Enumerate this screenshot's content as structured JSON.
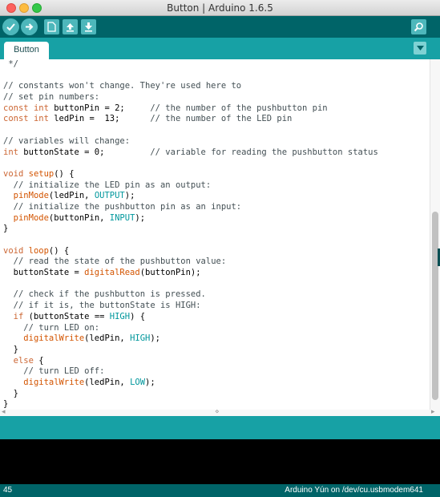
{
  "window": {
    "title": "Button | Arduino 1.6.5"
  },
  "toolbar": {
    "buttons": [
      {
        "name": "verify",
        "icon": "check-icon"
      },
      {
        "name": "upload",
        "icon": "arrow-right-icon"
      },
      {
        "name": "new",
        "icon": "new-file-icon"
      },
      {
        "name": "open",
        "icon": "open-arrow-up-icon"
      },
      {
        "name": "save",
        "icon": "save-arrow-down-icon"
      }
    ],
    "serial_monitor_icon": "magnifier-icon"
  },
  "tabs": {
    "active_label": "Button",
    "menu_icon": "triangle-down-icon"
  },
  "editor": {
    "lines": [
      [
        {
          "t": " */",
          "c": "com"
        }
      ],
      [
        {
          "t": "",
          "c": ""
        }
      ],
      [
        {
          "t": "// constants won't change. They're used here to",
          "c": "com"
        }
      ],
      [
        {
          "t": "// set pin numbers:",
          "c": "com"
        }
      ],
      [
        {
          "t": "const",
          "c": "kw"
        },
        {
          "t": " ",
          "c": ""
        },
        {
          "t": "int",
          "c": "kw"
        },
        {
          "t": " buttonPin = 2;     ",
          "c": ""
        },
        {
          "t": "// the number of the pushbutton pin",
          "c": "com"
        }
      ],
      [
        {
          "t": "const",
          "c": "kw"
        },
        {
          "t": " ",
          "c": ""
        },
        {
          "t": "int",
          "c": "kw"
        },
        {
          "t": " ledPin =  13;      ",
          "c": ""
        },
        {
          "t": "// the number of the LED pin",
          "c": "com"
        }
      ],
      [
        {
          "t": "",
          "c": ""
        }
      ],
      [
        {
          "t": "// variables will change:",
          "c": "com"
        }
      ],
      [
        {
          "t": "int",
          "c": "kw"
        },
        {
          "t": " buttonState = 0;         ",
          "c": ""
        },
        {
          "t": "// variable for reading the pushbutton status",
          "c": "com"
        }
      ],
      [
        {
          "t": "",
          "c": ""
        }
      ],
      [
        {
          "t": "void",
          "c": "kw"
        },
        {
          "t": " ",
          "c": ""
        },
        {
          "t": "setup",
          "c": "fn"
        },
        {
          "t": "() {",
          "c": ""
        }
      ],
      [
        {
          "t": "  ",
          "c": ""
        },
        {
          "t": "// initialize the LED pin as an output:",
          "c": "com"
        }
      ],
      [
        {
          "t": "  ",
          "c": ""
        },
        {
          "t": "pinMode",
          "c": "fn"
        },
        {
          "t": "(ledPin, ",
          "c": ""
        },
        {
          "t": "OUTPUT",
          "c": "cst"
        },
        {
          "t": ");",
          "c": ""
        }
      ],
      [
        {
          "t": "  ",
          "c": ""
        },
        {
          "t": "// initialize the pushbutton pin as an input:",
          "c": "com"
        }
      ],
      [
        {
          "t": "  ",
          "c": ""
        },
        {
          "t": "pinMode",
          "c": "fn"
        },
        {
          "t": "(buttonPin, ",
          "c": ""
        },
        {
          "t": "INPUT",
          "c": "cst"
        },
        {
          "t": ");",
          "c": ""
        }
      ],
      [
        {
          "t": "}",
          "c": ""
        }
      ],
      [
        {
          "t": "",
          "c": ""
        }
      ],
      [
        {
          "t": "void",
          "c": "kw"
        },
        {
          "t": " ",
          "c": ""
        },
        {
          "t": "loop",
          "c": "fn"
        },
        {
          "t": "() {",
          "c": ""
        }
      ],
      [
        {
          "t": "  ",
          "c": ""
        },
        {
          "t": "// read the state of the pushbutton value:",
          "c": "com"
        }
      ],
      [
        {
          "t": "  buttonState = ",
          "c": ""
        },
        {
          "t": "digitalRead",
          "c": "fn"
        },
        {
          "t": "(buttonPin);",
          "c": ""
        }
      ],
      [
        {
          "t": "",
          "c": ""
        }
      ],
      [
        {
          "t": "  ",
          "c": ""
        },
        {
          "t": "// check if the pushbutton is pressed.",
          "c": "com"
        }
      ],
      [
        {
          "t": "  ",
          "c": ""
        },
        {
          "t": "// if it is, the buttonState is HIGH:",
          "c": "com"
        }
      ],
      [
        {
          "t": "  ",
          "c": ""
        },
        {
          "t": "if",
          "c": "kw"
        },
        {
          "t": " (buttonState == ",
          "c": ""
        },
        {
          "t": "HIGH",
          "c": "cst"
        },
        {
          "t": ") {",
          "c": ""
        }
      ],
      [
        {
          "t": "    ",
          "c": ""
        },
        {
          "t": "// turn LED on:",
          "c": "com"
        }
      ],
      [
        {
          "t": "    ",
          "c": ""
        },
        {
          "t": "digitalWrite",
          "c": "fn"
        },
        {
          "t": "(ledPin, ",
          "c": ""
        },
        {
          "t": "HIGH",
          "c": "cst"
        },
        {
          "t": ");",
          "c": ""
        }
      ],
      [
        {
          "t": "  }",
          "c": ""
        }
      ],
      [
        {
          "t": "  ",
          "c": ""
        },
        {
          "t": "else",
          "c": "kw"
        },
        {
          "t": " {",
          "c": ""
        }
      ],
      [
        {
          "t": "    ",
          "c": ""
        },
        {
          "t": "// turn LED off:",
          "c": "com"
        }
      ],
      [
        {
          "t": "    ",
          "c": ""
        },
        {
          "t": "digitalWrite",
          "c": "fn"
        },
        {
          "t": "(ledPin, ",
          "c": ""
        },
        {
          "t": "LOW",
          "c": "cst"
        },
        {
          "t": ");",
          "c": ""
        }
      ],
      [
        {
          "t": "  }",
          "c": ""
        }
      ],
      [
        {
          "t": "}",
          "c": ""
        }
      ]
    ]
  },
  "status": {
    "line_number": "45",
    "board": "Arduino Yún on /dev/cu.usbmodem641"
  },
  "colors": {
    "toolbar": "#006468",
    "tabbar": "#17a1a5",
    "keyword": "#cc6633",
    "function": "#d35400",
    "constant": "#00979c",
    "comment": "#434f54"
  }
}
